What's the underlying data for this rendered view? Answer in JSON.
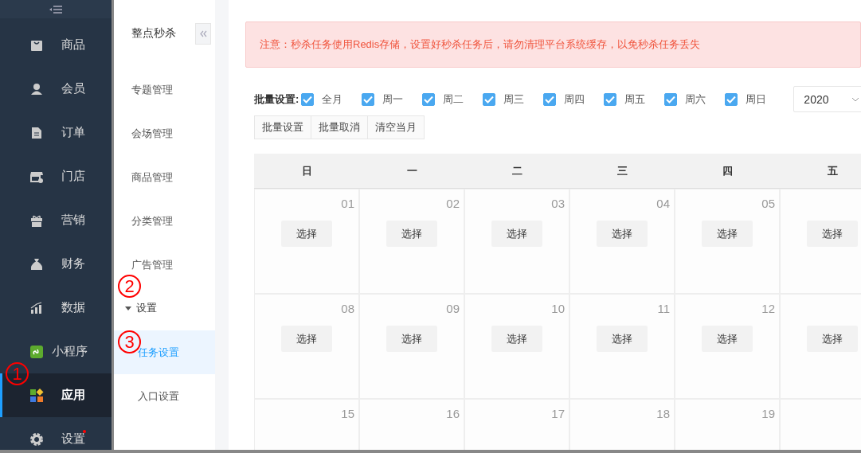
{
  "sidebar": {
    "items": [
      {
        "label": "商品",
        "kind": "bag",
        "selected": false,
        "badge": false
      },
      {
        "label": "会员",
        "kind": "person",
        "selected": false,
        "badge": false
      },
      {
        "label": "订单",
        "kind": "document",
        "selected": false,
        "badge": false
      },
      {
        "label": "门店",
        "kind": "store",
        "selected": false,
        "badge": false
      },
      {
        "label": "营销",
        "kind": "gift",
        "selected": false,
        "badge": false
      },
      {
        "label": "财务",
        "kind": "moneybag",
        "selected": false,
        "badge": false
      },
      {
        "label": "数据",
        "kind": "chart",
        "selected": false,
        "badge": false
      },
      {
        "label": "小程序",
        "kind": "miniapp",
        "selected": false,
        "badge": false
      },
      {
        "label": "应用",
        "kind": "apps",
        "selected": true,
        "badge": false
      },
      {
        "label": "设置",
        "kind": "gear",
        "selected": false,
        "badge": true
      }
    ]
  },
  "submenu": {
    "title": "整点秒杀",
    "items": [
      {
        "label": "专题管理",
        "selected": false
      },
      {
        "label": "会场管理",
        "selected": false
      },
      {
        "label": "商品管理",
        "selected": false
      },
      {
        "label": "分类管理",
        "selected": false
      },
      {
        "label": "广告管理",
        "selected": false
      },
      {
        "label": "设置",
        "expanded": true,
        "children": [
          {
            "label": "任务设置",
            "selected": true
          },
          {
            "label": "入口设置",
            "selected": false
          }
        ]
      }
    ]
  },
  "annotations": [
    {
      "text": "1"
    },
    {
      "text": "2"
    },
    {
      "text": "3"
    }
  ],
  "alert": "注意：秒杀任务使用Redis存储，设置好秒杀任务后，请勿清理平台系统缓存，以免秒杀任务丢失",
  "batch": {
    "label": "批量设置:",
    "options": [
      {
        "label": "全月",
        "checked": true
      },
      {
        "label": "周一",
        "checked": true
      },
      {
        "label": "周二",
        "checked": true
      },
      {
        "label": "周三",
        "checked": true
      },
      {
        "label": "周四",
        "checked": true
      },
      {
        "label": "周五",
        "checked": true
      },
      {
        "label": "周六",
        "checked": true
      },
      {
        "label": "周日",
        "checked": true
      }
    ],
    "year": "2020",
    "buttons": [
      "批量设置",
      "批量取消",
      "清空当月"
    ]
  },
  "calendar": {
    "weekdays": [
      "日",
      "一",
      "二",
      "三",
      "四",
      "五"
    ],
    "weeks": [
      [
        {
          "day": "01",
          "button": "选择"
        },
        {
          "day": "02",
          "button": "选择"
        },
        {
          "day": "03",
          "button": "选择"
        },
        {
          "day": "04",
          "button": "选择"
        },
        {
          "day": "05",
          "button": "选择"
        },
        {
          "button": "选择"
        }
      ],
      [
        {
          "day": "08",
          "button": "选择"
        },
        {
          "day": "09",
          "button": "选择"
        },
        {
          "day": "10",
          "button": "选择"
        },
        {
          "day": "11",
          "button": "选择"
        },
        {
          "day": "12",
          "button": "选择"
        },
        {
          "button": "选择"
        }
      ],
      [
        {
          "day": "15"
        },
        {
          "day": "16"
        },
        {
          "day": "17"
        },
        {
          "day": "18"
        },
        {
          "day": "19"
        }
      ]
    ]
  }
}
